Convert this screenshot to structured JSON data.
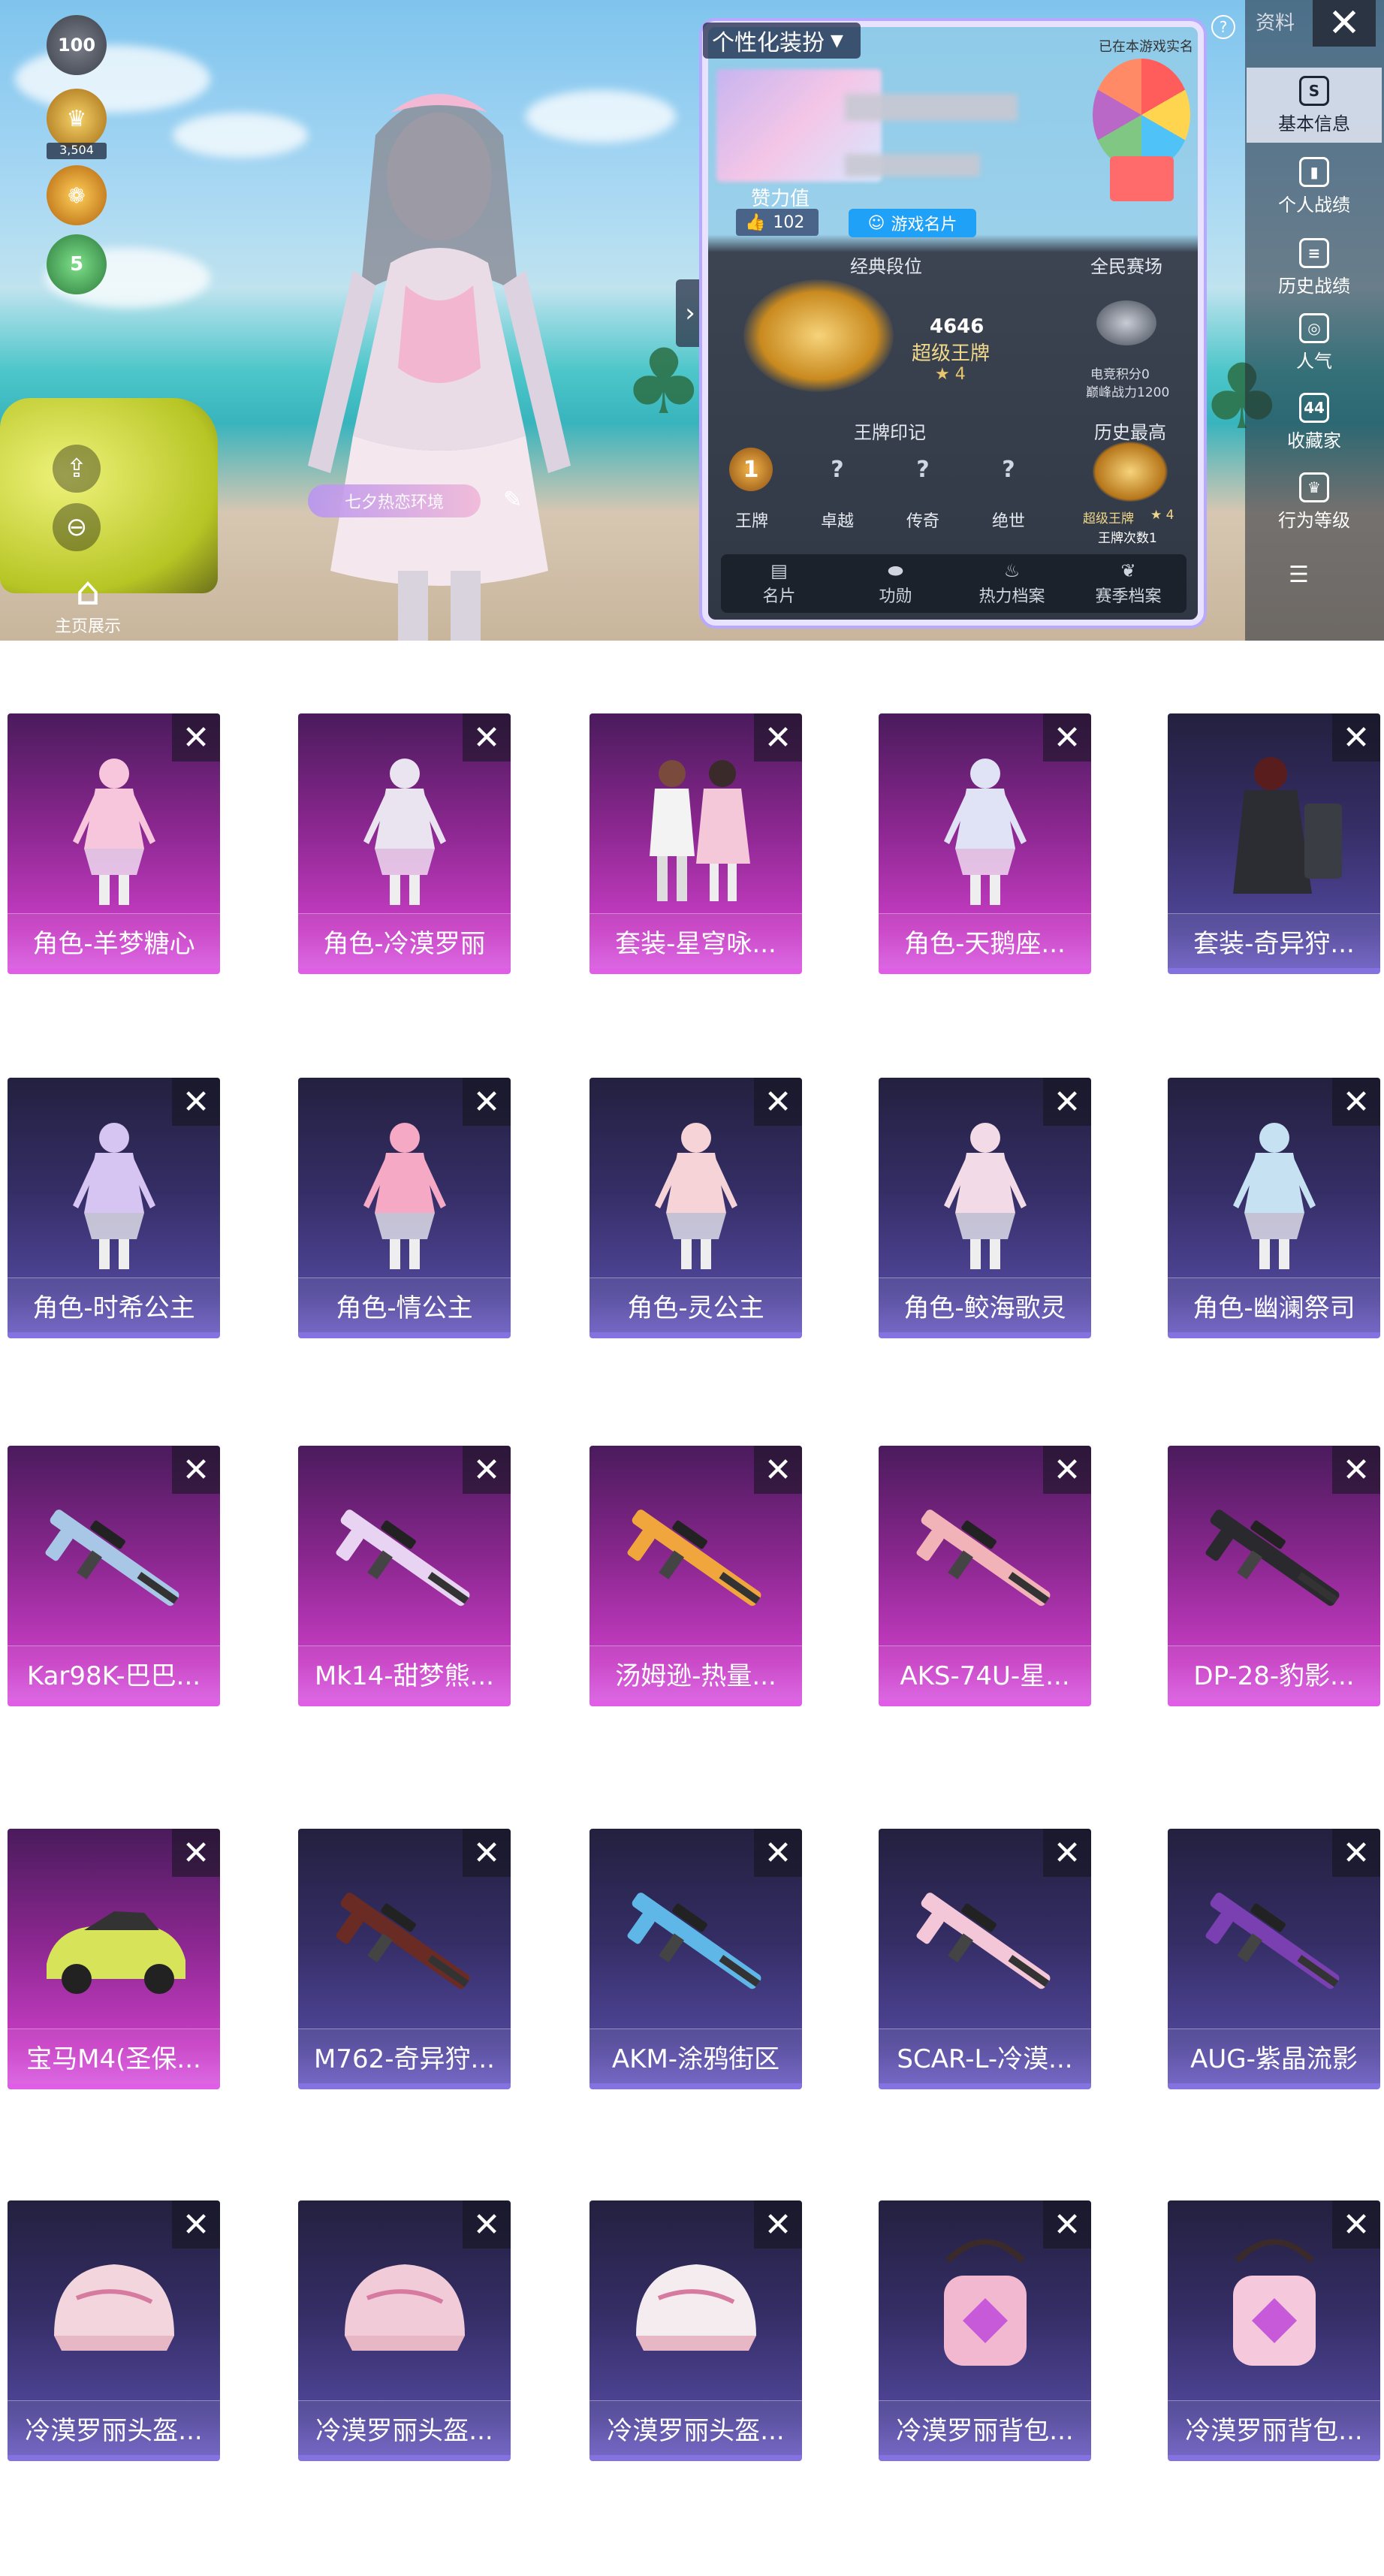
{
  "banner": {
    "left_badges": [
      "100",
      "3,504"
    ],
    "left_badge_numbers": {
      "level": "100",
      "value": "3,504"
    },
    "small_badge": "5",
    "home_label": "主页展示",
    "character_tag": "七夕热恋环境",
    "collapse_arrow": "›"
  },
  "profile_card": {
    "dropdown_label": "个性化装扮",
    "verified_text": "已在本游戏实名",
    "likes_label": "赞力值",
    "likes_count": "102",
    "game_card_button": "游戏名片",
    "classic_rank": {
      "heading": "经典段位",
      "score": "4646",
      "tier": "超级王牌",
      "stars": "★ 4"
    },
    "all_people": {
      "heading": "全民赛场",
      "esports_points": "电竞积分0",
      "peak_power": "巅峰战力1200"
    },
    "ace_mark": {
      "heading": "王牌印记",
      "badges": [
        {
          "label": "王牌",
          "glyph": "1"
        },
        {
          "label": "卓越",
          "glyph": "?"
        },
        {
          "label": "传奇",
          "glyph": "?"
        },
        {
          "label": "绝世",
          "glyph": "?"
        }
      ]
    },
    "history_high": {
      "heading": "历史最高",
      "tier": "超级王牌",
      "stars": "★ 4",
      "count": "王牌次数1"
    },
    "tabs": [
      {
        "label": "名片",
        "icon": "id-card-icon"
      },
      {
        "label": "功勋",
        "icon": "medal-icon"
      },
      {
        "label": "热力档案",
        "icon": "flame-icon"
      },
      {
        "label": "赛季档案",
        "icon": "laurel-icon"
      }
    ]
  },
  "right_panel": {
    "top_label": "资料",
    "close_glyph": "✕",
    "items": [
      {
        "label": "基本信息",
        "glyph": "S"
      },
      {
        "label": "个人战绩",
        "glyph": "▮"
      },
      {
        "label": "历史战绩",
        "glyph": "≡"
      },
      {
        "label": "人气",
        "glyph": "◎"
      },
      {
        "label": "收藏家",
        "glyph": "44"
      },
      {
        "label": "行为等级",
        "glyph": "♛"
      }
    ],
    "menu_glyph": "☰"
  },
  "items_grid": [
    [
      {
        "label": "角色-羊梦糖心",
        "rarity": "purple",
        "kind": "character",
        "color": "#f7c6dc"
      },
      {
        "label": "角色-冷漠罗丽",
        "rarity": "purple",
        "kind": "character",
        "color": "#e9e4f0"
      },
      {
        "label": "套装-星穹咏...",
        "rarity": "purple",
        "kind": "duo",
        "color": "#f4c8d8"
      },
      {
        "label": "角色-天鹅座...",
        "rarity": "purple",
        "kind": "character",
        "color": "#dfe3f5"
      },
      {
        "label": "套装-奇异狩...",
        "rarity": "blue",
        "kind": "suit-dark",
        "color": "#2b2d33"
      }
    ],
    [
      {
        "label": "角色-时希公主",
        "rarity": "blue",
        "kind": "character",
        "color": "#d6c4f2"
      },
      {
        "label": "角色-情公主",
        "rarity": "blue",
        "kind": "character",
        "color": "#f6a9c4"
      },
      {
        "label": "角色-灵公主",
        "rarity": "blue",
        "kind": "character",
        "color": "#f5d3d6"
      },
      {
        "label": "角色-鲛海歌灵",
        "rarity": "blue",
        "kind": "character",
        "color": "#f2dbe6"
      },
      {
        "label": "角色-幽澜祭司",
        "rarity": "blue",
        "kind": "character",
        "color": "#c6e2f2"
      }
    ],
    [
      {
        "label": "Kar98K-巴巴...",
        "rarity": "purple",
        "kind": "rifle",
        "color": "#a8c7e6"
      },
      {
        "label": "Mk14-甜梦熊...",
        "rarity": "purple",
        "kind": "rifle",
        "color": "#e8d3f2"
      },
      {
        "label": "汤姆逊-热量...",
        "rarity": "purple",
        "kind": "rifle",
        "color": "#f0a63c"
      },
      {
        "label": "AKS-74U-星...",
        "rarity": "purple",
        "kind": "rifle",
        "color": "#f2b3b8"
      },
      {
        "label": "DP-28-豹影...",
        "rarity": "purple",
        "kind": "rifle",
        "color": "#2a2a2e"
      }
    ],
    [
      {
        "label": "宝马M4(圣保...",
        "rarity": "purple",
        "kind": "car",
        "color": "#d7e45a"
      },
      {
        "label": "M762-奇异狩...",
        "rarity": "blue",
        "kind": "rifle",
        "color": "#6a2b24"
      },
      {
        "label": "AKM-涂鸦街区",
        "rarity": "blue",
        "kind": "rifle",
        "color": "#5fb7e8"
      },
      {
        "label": "SCAR-L-冷漠...",
        "rarity": "blue",
        "kind": "rifle",
        "color": "#f3c7d8"
      },
      {
        "label": "AUG-紫晶流影",
        "rarity": "blue",
        "kind": "rifle",
        "color": "#7a3fb0"
      }
    ],
    [
      {
        "label": "冷漠罗丽头盔...",
        "rarity": "blue",
        "kind": "helmet",
        "color": "#f3d5de"
      },
      {
        "label": "冷漠罗丽头盔...",
        "rarity": "blue",
        "kind": "helmet",
        "color": "#f1cbd8"
      },
      {
        "label": "冷漠罗丽头盔...",
        "rarity": "blue",
        "kind": "helmet",
        "color": "#f4ecef"
      },
      {
        "label": "冷漠罗丽背包...",
        "rarity": "blue",
        "kind": "backpack",
        "color": "#f2b8d0"
      },
      {
        "label": "冷漠罗丽背包...",
        "rarity": "blue",
        "kind": "backpack",
        "color": "#f5c8dc"
      }
    ]
  ],
  "remove_glyph": "✕"
}
